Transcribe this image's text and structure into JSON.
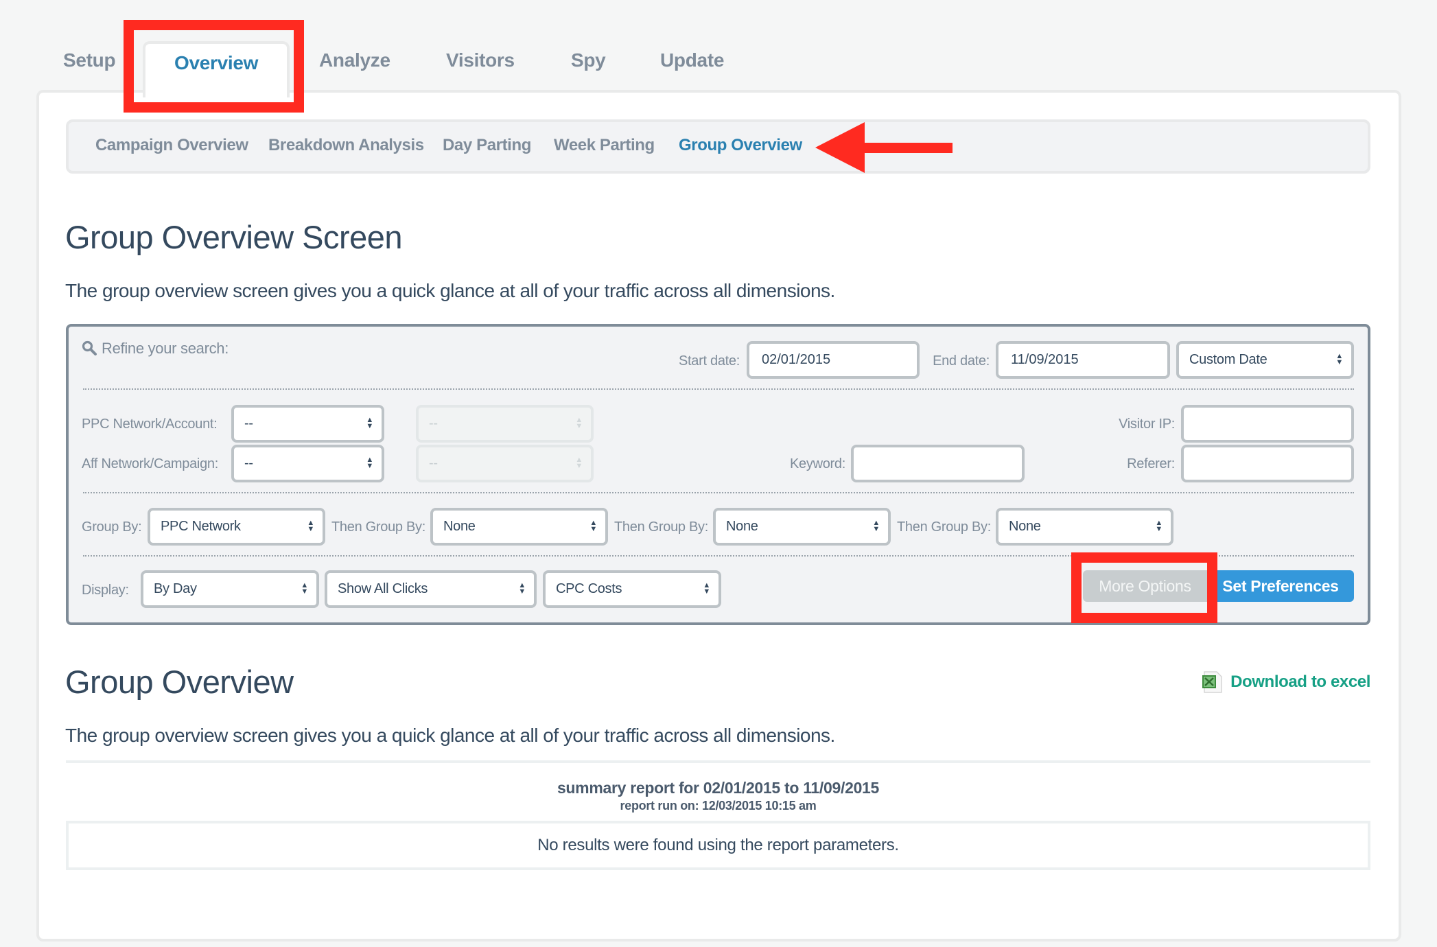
{
  "top_tabs": [
    {
      "label": "Setup",
      "active": false
    },
    {
      "label": "Overview",
      "active": true
    },
    {
      "label": "Analyze",
      "active": false
    },
    {
      "label": "Visitors",
      "active": false
    },
    {
      "label": "Spy",
      "active": false
    },
    {
      "label": "Update",
      "active": false
    }
  ],
  "sub_nav": [
    {
      "label": "Campaign Overview",
      "active": false
    },
    {
      "label": "Breakdown Analysis",
      "active": false
    },
    {
      "label": "Day Parting",
      "active": false
    },
    {
      "label": "Week Parting",
      "active": false
    },
    {
      "label": "Group Overview",
      "active": true
    }
  ],
  "page": {
    "title": "Group Overview Screen",
    "description": "The group overview screen gives you a quick glance at all of your traffic across all dimensions."
  },
  "search": {
    "heading": "Refine your search:",
    "icon": "search-icon",
    "start_date_label": "Start date:",
    "start_date_value": "02/01/2015",
    "end_date_label": "End date:",
    "end_date_value": "11/09/2015",
    "date_range_select": "Custom Date",
    "ppc_label": "PPC Network/Account:",
    "ppc_network_select": "--",
    "ppc_account_select": "--",
    "aff_label": "Aff Network/Campaign:",
    "aff_network_select": "--",
    "aff_campaign_select": "--",
    "keyword_label": "Keyword:",
    "keyword_value": "",
    "visitor_ip_label": "Visitor IP:",
    "visitor_ip_value": "",
    "referer_label": "Referer:",
    "referer_value": "",
    "group_by_label": "Group By:",
    "group_by_value": "PPC Network",
    "then_group_by_label": "Then Group By:",
    "then_group_by_1": "None",
    "then_group_by_2": "None",
    "then_group_by_3": "None",
    "display_label": "Display:",
    "display_period": "By Day",
    "display_clicks": "Show All Clicks",
    "display_costs": "CPC Costs",
    "more_options_label": "More Options",
    "set_preferences_label": "Set Preferences"
  },
  "report": {
    "title": "Group Overview",
    "description": "The group overview screen gives you a quick glance at all of your traffic across all dimensions.",
    "download_label": "Download to excel",
    "summary_title": "summary report for 02/01/2015 to 11/09/2015",
    "run_on": "report run on: 12/03/2015 10:15 am",
    "empty_message": "No results were found using the report parameters."
  },
  "annotations": {
    "highlight_color": "#ff2a20"
  },
  "colors": {
    "accent_blue": "#2a80b0",
    "primary_button": "#3498db",
    "download_link": "#16a085"
  }
}
